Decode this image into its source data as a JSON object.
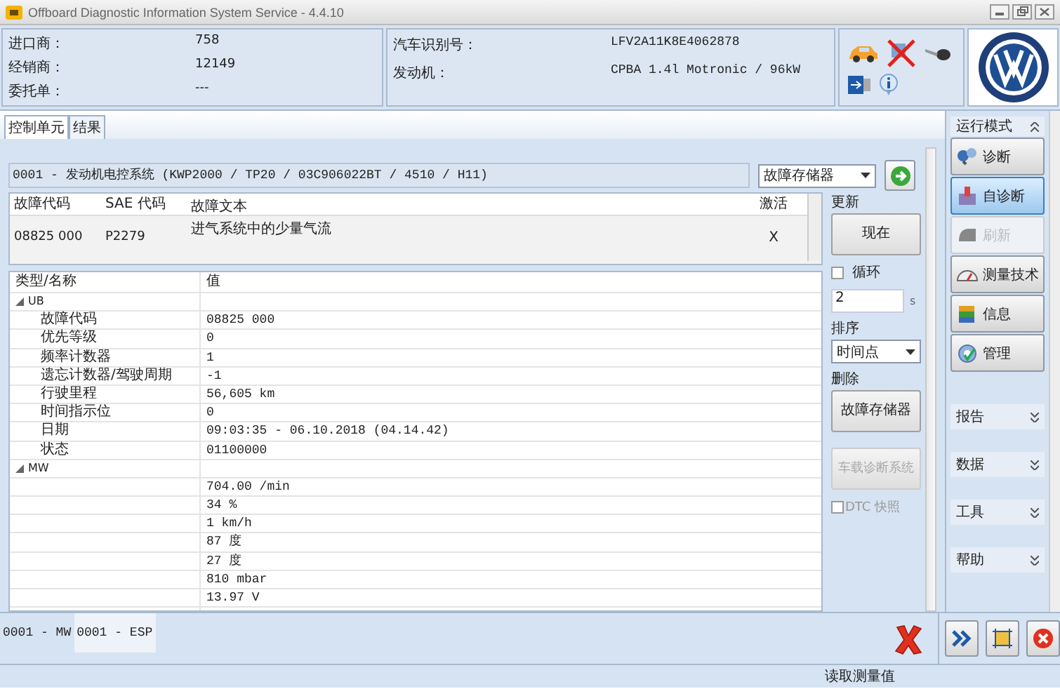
{
  "window": {
    "title": "Offboard Diagnostic Information System Service - 4.4.10"
  },
  "info_left": [
    {
      "label": "进口商：",
      "value": "758"
    },
    {
      "label": "经销商：",
      "value": "12149"
    },
    {
      "label": "委托单：",
      "value": "---"
    }
  ],
  "info_right": [
    {
      "label": "汽车识别号：",
      "value": "LFV2A11K8E4062878"
    },
    {
      "label": "发动机：",
      "value": "CPBA 1.4l Motronic / 96kW"
    }
  ],
  "tabs": [
    {
      "label": "控制单元",
      "selected": true
    },
    {
      "label": "结果",
      "selected": false
    }
  ],
  "ecu": {
    "value": "0001 - 发动机电控系统  (KWP2000 / TP20 / 03C906022BT / 4510 / H11)"
  },
  "memory_select": {
    "value": "故障存储器"
  },
  "fault_table": {
    "columns": [
      "故障代码",
      "SAE 代码",
      "故障文本",
      "激活"
    ],
    "rows": [
      {
        "cells": [
          "08825 000",
          "P2279",
          "进气系统中的少量气流",
          "X"
        ]
      }
    ]
  },
  "details": {
    "columns": [
      "类型/名称",
      "值"
    ],
    "groups": [
      {
        "label": "UB",
        "expanded": true,
        "children": [
          {
            "name": "故障代码",
            "value": "08825 000"
          },
          {
            "name": "优先等级",
            "value": "0"
          },
          {
            "name": "频率计数器",
            "value": "1"
          },
          {
            "name": "遗忘计数器/驾驶周期",
            "value": "-1"
          },
          {
            "name": "行驶里程",
            "value": "56,605 km"
          },
          {
            "name": "时间指示位",
            "value": "0"
          },
          {
            "name": "日期",
            "value": "09:03:35 - 06.10.2018  (04.14.42)"
          },
          {
            "name": "状态",
            "value": "01100000"
          }
        ]
      },
      {
        "label": "MW",
        "expanded": true,
        "children": [
          {
            "value": "704.00 /min"
          },
          {
            "value": "34 %"
          },
          {
            "value": "1 km/h"
          },
          {
            "value": "87 度"
          },
          {
            "value": "27 度"
          },
          {
            "value": "810 mbar"
          },
          {
            "value": "13.97 V"
          }
        ]
      }
    ]
  },
  "controls": {
    "update_label": "更新",
    "now_button": "现在",
    "cycle": {
      "label": "循环",
      "checked": false
    },
    "interval": {
      "value": "2",
      "unit": "s"
    },
    "sort_label": "排序",
    "sort_select": "时间点",
    "delete_label": "删除",
    "delete_button": "故障存储器",
    "obd_button": {
      "label": "车载诊断系统",
      "disabled": true
    },
    "dtc_snapshot": {
      "label": "DTC 快照",
      "checked": false,
      "disabled": true
    }
  },
  "sidebar": {
    "title": "运行模式",
    "buttons": [
      {
        "label": "诊断",
        "selected": false,
        "disabled": false
      },
      {
        "label": "自诊断",
        "selected": true,
        "disabled": false
      },
      {
        "label": "刷新",
        "selected": false,
        "disabled": true
      },
      {
        "label": "测量技术",
        "selected": false,
        "disabled": false
      },
      {
        "label": "信息",
        "selected": false,
        "disabled": false
      },
      {
        "label": "管理",
        "selected": false,
        "disabled": false
      }
    ],
    "sections": [
      "报告",
      "数据",
      "工具",
      "帮助"
    ]
  },
  "bottom_tabs": [
    {
      "label": "0001 - MW",
      "selected": false
    },
    {
      "label": "0001 - ESP",
      "selected": true
    }
  ],
  "status_bar": "读取测量值"
}
